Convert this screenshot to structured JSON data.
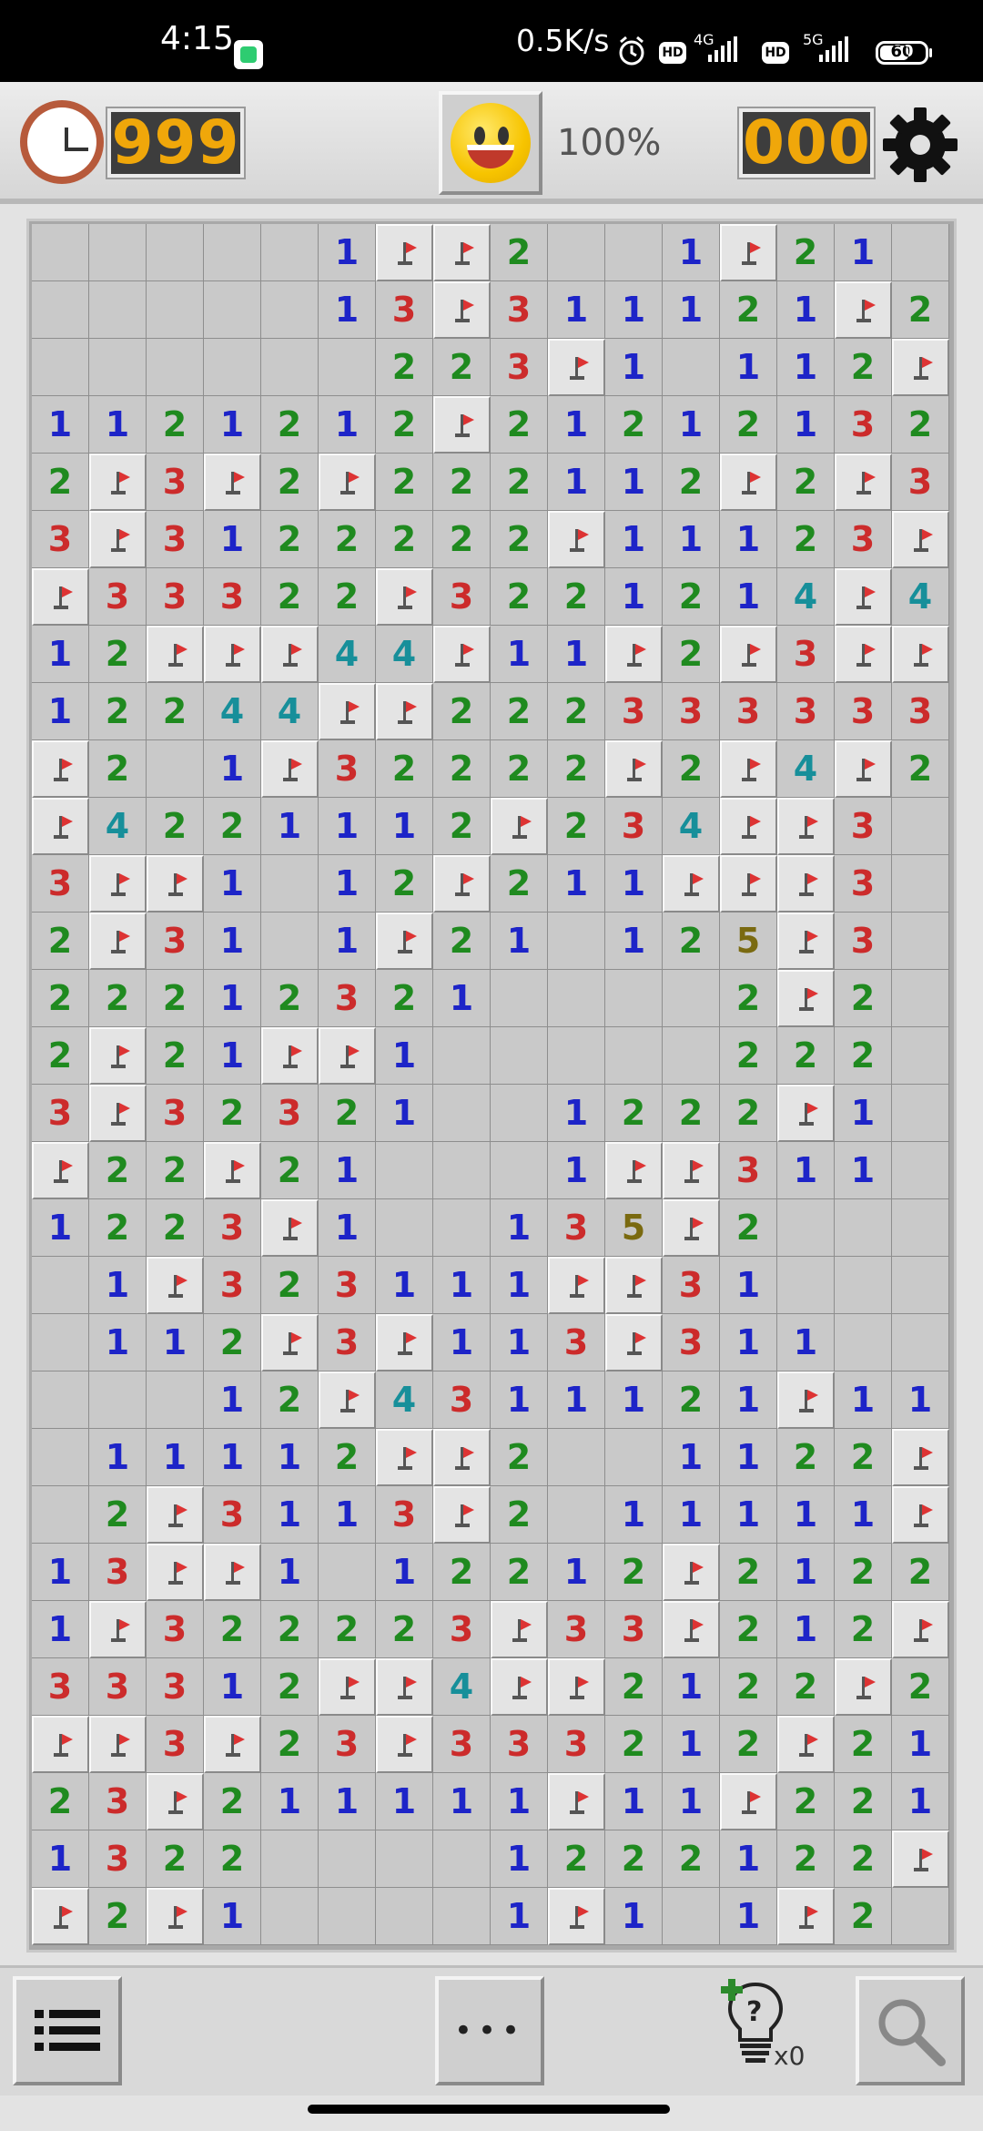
{
  "status_bar": {
    "time": "4:15",
    "net_speed": "0.5K/s",
    "hd1": "HD",
    "net1": "4G",
    "hd2": "HD",
    "net2": "5G",
    "battery": "60"
  },
  "header": {
    "timer": "999",
    "zoom": "100%",
    "mines_left": "000",
    "icons": [
      "clock-icon",
      "smiley-face-icon",
      "gear-icon"
    ]
  },
  "board": {
    "columns": 16,
    "rows": 30,
    "legend": "F = flag, . = empty revealed, digits = adjacent mine counts",
    "number_colors": {
      "1": "#1d24c8",
      "2": "#1f8a1f",
      "3": "#cc2b2b",
      "4": "#178f9a",
      "5": "#7a6a10"
    },
    "grid": [
      ".....1FF2..1F21.",
      ".....13F311121F21",
      "......223F1.112F",
      "1121212F21212132",
      "2F3F2F222112F2F3F",
      "3F3122222F11123F3",
      "F33322F3221214F4",
      "12FFF44F11F2F3FF",
      "1224 4FF2223 3333 32",
      "F2.1F32222F2F4F2.",
      "F4221112F234FF3.",
      "3FF1.12F211FFF3.",
      "2F31.1F21.125F3.",
      "22212321....2F2.",
      "2F21FF1.....222.",
      "3F32321..1222F1.",
      "F22F21...1FF311.",
      "1223F1..135F2...",
      ".1F32311 1FF31...",
      ".112F3F113F311..",
      "...12F4311121F111",
      ".11112FF2..112 2F",
      ".2F3113F2.11111F2",
      "13FF1.12212F2122",
      "1F322223F33F212F",
      "3331 2FF4FF212 2F2",
      "FF3F23F3332 12F21",
      "23F211111F11F221",
      "1322....1222122F",
      "F2F1....1F1.1F2"
    ]
  },
  "toolbar": {
    "menu_icon": "list-menu-icon",
    "more_label": "•••",
    "hint_count": "x0",
    "search_icon": "magnifier-icon"
  }
}
